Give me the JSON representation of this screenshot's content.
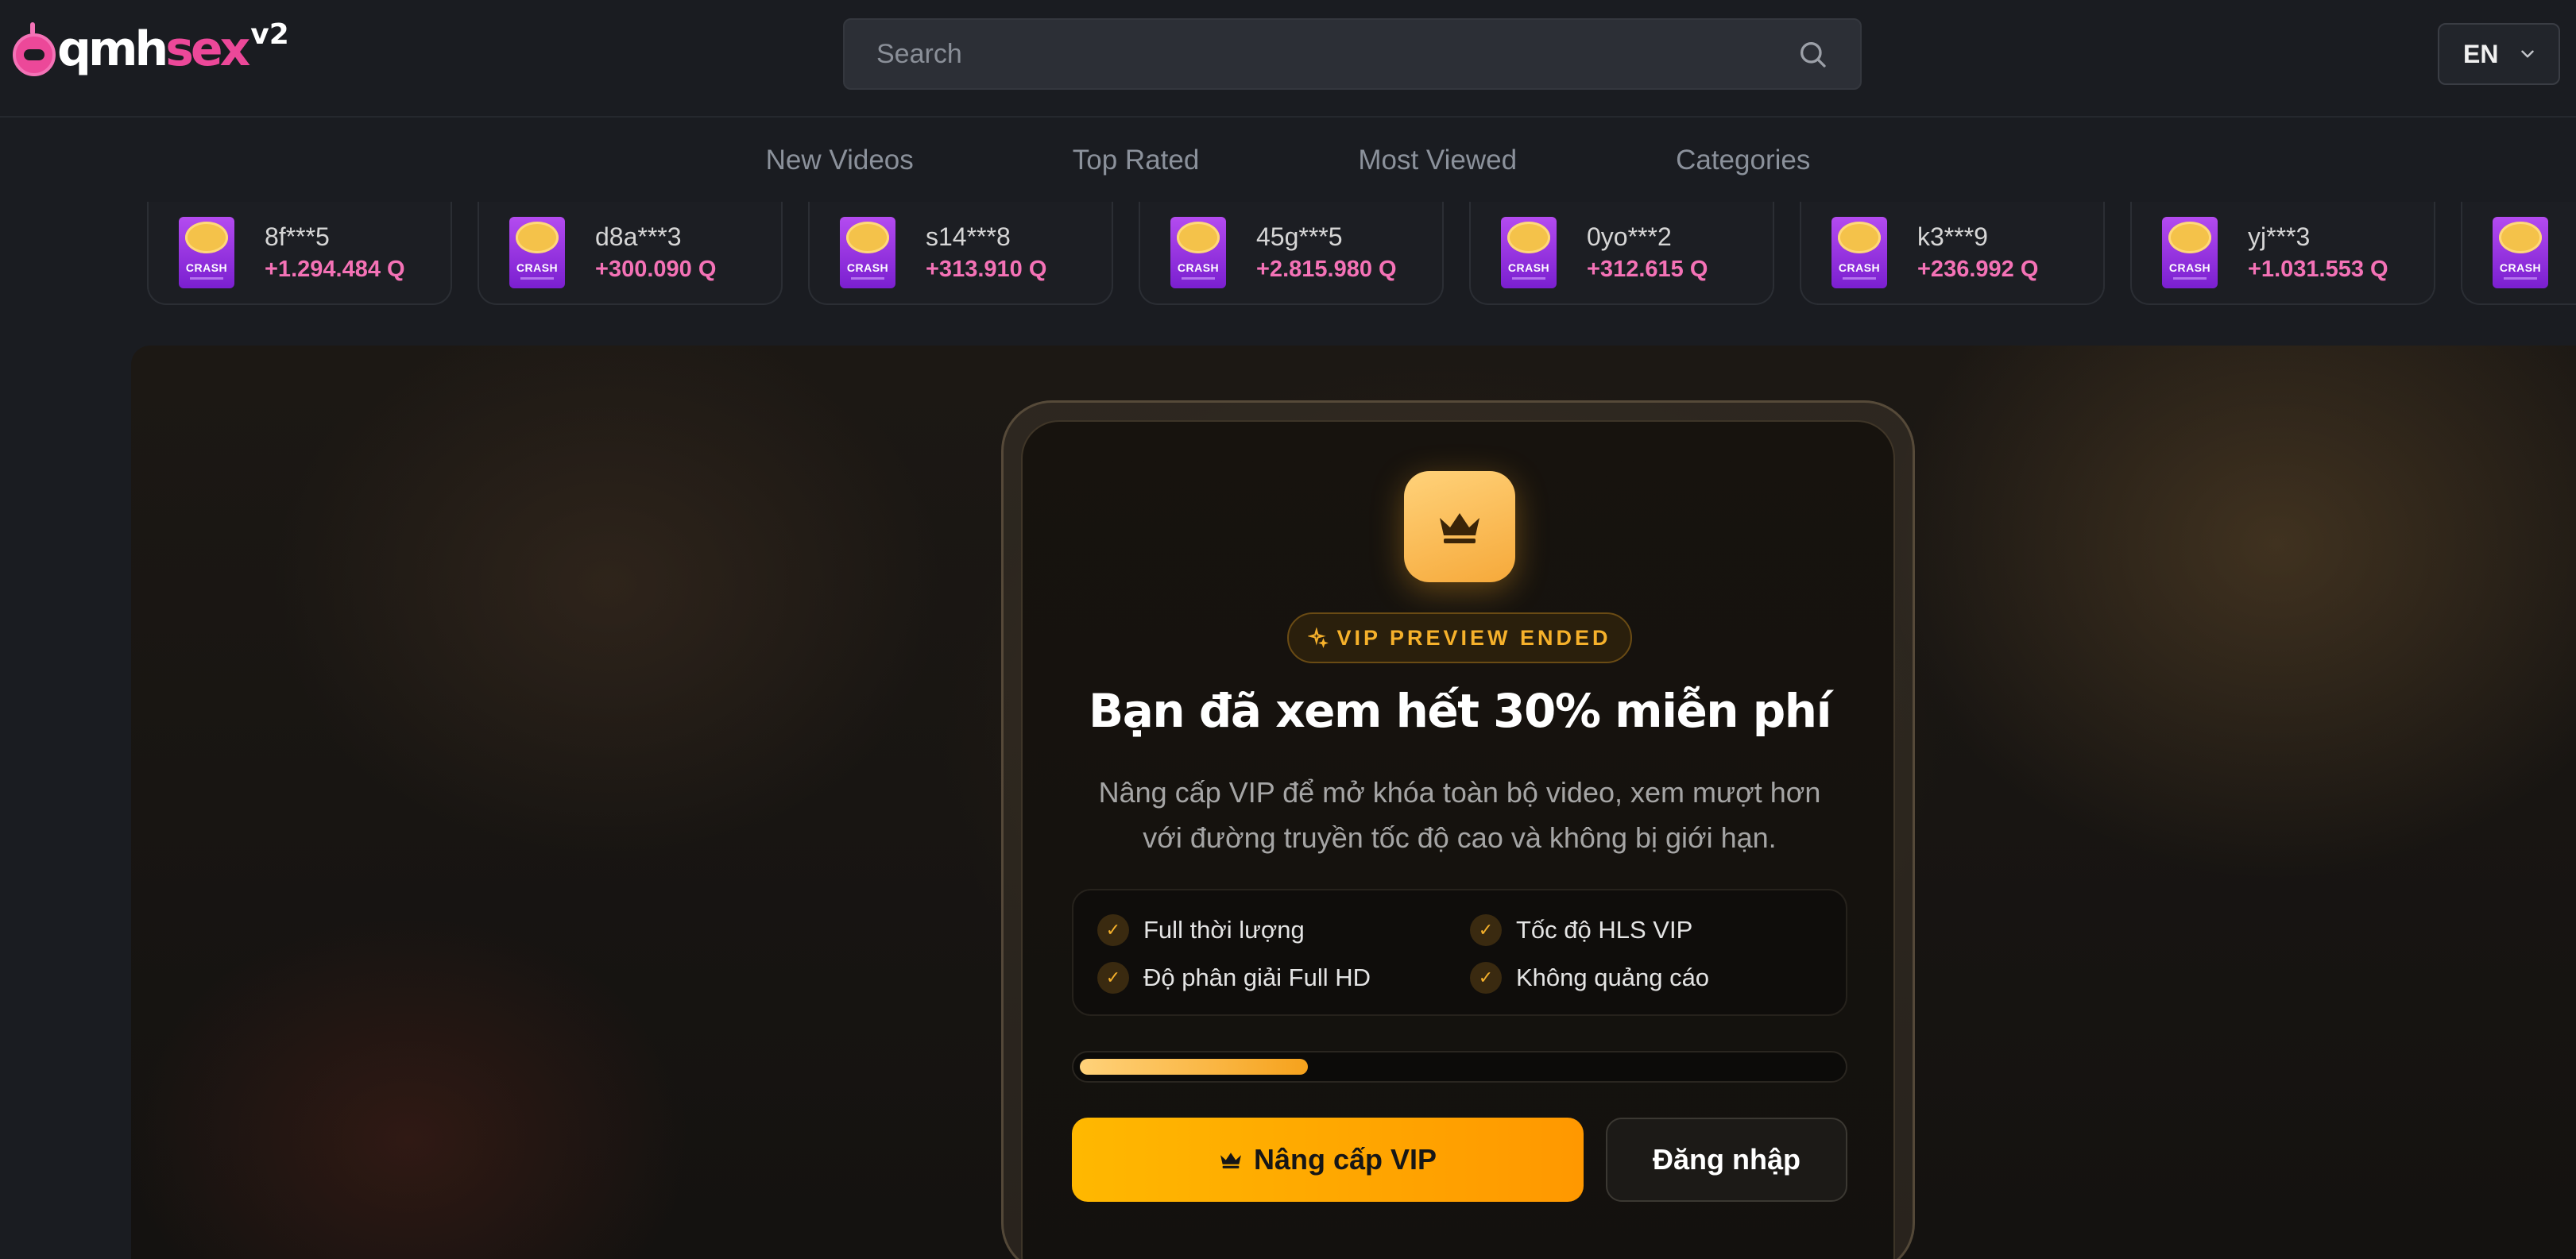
{
  "header": {
    "logo": {
      "text_main": "qmh",
      "text_accent": "sex",
      "sup": "v2"
    },
    "search": {
      "placeholder": "Search"
    },
    "language": {
      "selected": "EN"
    }
  },
  "nav": {
    "items": [
      {
        "label": "New Videos"
      },
      {
        "label": "Top Rated"
      },
      {
        "label": "Most Viewed"
      },
      {
        "label": "Categories"
      }
    ]
  },
  "ticker": {
    "game_label": "CRASH",
    "items": [
      {
        "user": "8f***5",
        "amount": "+1.294.484 Q"
      },
      {
        "user": "d8a***3",
        "amount": "+300.090 Q"
      },
      {
        "user": "s14***8",
        "amount": "+313.910 Q"
      },
      {
        "user": "45g***5",
        "amount": "+2.815.980 Q"
      },
      {
        "user": "0yo***2",
        "amount": "+312.615 Q"
      },
      {
        "user": "k3***9",
        "amount": "+236.992 Q"
      },
      {
        "user": "yj***3",
        "amount": "+1.031.553 Q"
      }
    ]
  },
  "modal": {
    "icon": "crown-icon",
    "badge": "VIP PREVIEW ENDED",
    "title": "Bạn đã xem hết 30% miễn phí",
    "description_line1": "Nâng cấp VIP để mở khóa toàn bộ video, xem mượt hơn",
    "description_line2": "với đường truyền tốc độ cao và không bị giới hạn.",
    "features": [
      "Full thời lượng",
      "Tốc độ HLS VIP",
      "Độ phân giải Full HD",
      "Không quảng cáo"
    ],
    "preview_progress_percent": 30,
    "upgrade_button": "Nâng cấp VIP",
    "login_button": "Đăng nhập"
  },
  "colors": {
    "accent": "#f6a21c",
    "brand_pink": "#ec4899",
    "background": "#1a1c21"
  }
}
